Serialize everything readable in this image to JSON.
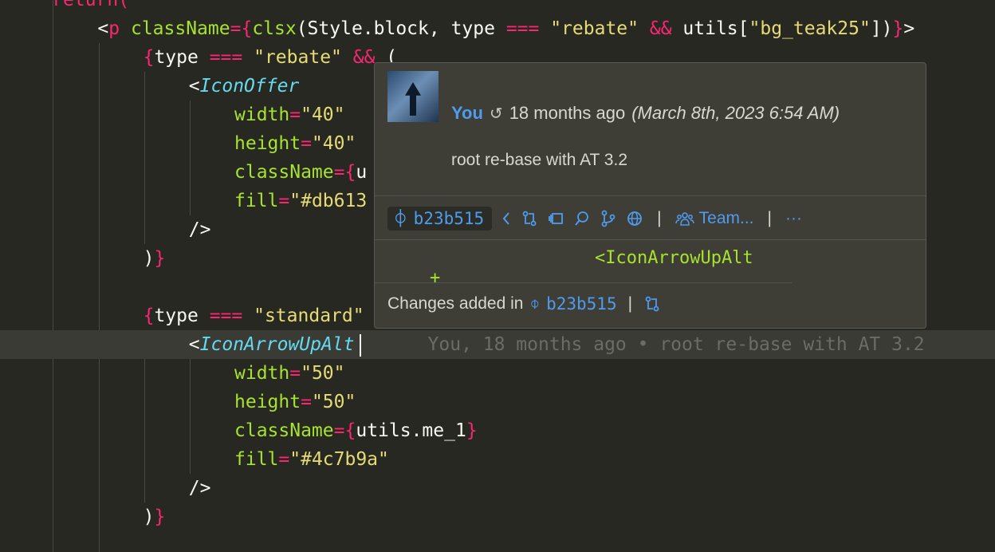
{
  "editor": {
    "lines": [
      {
        "indent": 2,
        "tokens": [
          [
            "tag",
            "return("
          ]
        ]
      },
      {
        "indent": 4,
        "tokens": [
          [
            "p",
            "<"
          ],
          [
            "tag",
            "p"
          ],
          [
            "p",
            " "
          ],
          [
            "attr",
            "className"
          ],
          [
            "op",
            "="
          ],
          [
            "brace",
            "{"
          ],
          [
            "attr",
            "clsx"
          ],
          [
            "p",
            "(Style.block, type "
          ],
          [
            "op",
            "==="
          ],
          [
            "p",
            " "
          ],
          [
            "str",
            "\"rebate\""
          ],
          [
            "p",
            " "
          ],
          [
            "op",
            "&&"
          ],
          [
            "p",
            " utils["
          ],
          [
            "str",
            "\"bg_teak25\""
          ],
          [
            "p",
            "])"
          ],
          [
            "brace",
            "}"
          ],
          [
            "p",
            ">"
          ]
        ]
      },
      {
        "indent": 6,
        "tokens": [
          [
            "brace",
            "{"
          ],
          [
            "p",
            "type "
          ],
          [
            "op",
            "==="
          ],
          [
            "p",
            " "
          ],
          [
            "str",
            "\"rebate\""
          ],
          [
            "p",
            " "
          ],
          [
            "op",
            "&&"
          ],
          [
            "p",
            " ("
          ]
        ]
      },
      {
        "indent": 8,
        "tokens": [
          [
            "p",
            "<"
          ],
          [
            "comp",
            "IconOffer"
          ]
        ]
      },
      {
        "indent": 10,
        "tokens": [
          [
            "attr",
            "width"
          ],
          [
            "op",
            "="
          ],
          [
            "str",
            "\"40\""
          ]
        ]
      },
      {
        "indent": 10,
        "tokens": [
          [
            "attr",
            "height"
          ],
          [
            "op",
            "="
          ],
          [
            "str",
            "\"40\""
          ]
        ]
      },
      {
        "indent": 10,
        "tokens": [
          [
            "attr",
            "className"
          ],
          [
            "op",
            "="
          ],
          [
            "brace",
            "{"
          ],
          [
            "p",
            "u"
          ]
        ]
      },
      {
        "indent": 10,
        "tokens": [
          [
            "attr",
            "fill"
          ],
          [
            "op",
            "="
          ],
          [
            "str",
            "\"#db613"
          ]
        ]
      },
      {
        "indent": 8,
        "tokens": [
          [
            "p",
            "/>"
          ]
        ]
      },
      {
        "indent": 6,
        "tokens": [
          [
            "p",
            ")"
          ],
          [
            "brace",
            "}"
          ]
        ]
      },
      {
        "indent": 0,
        "tokens": []
      },
      {
        "indent": 6,
        "tokens": [
          [
            "brace",
            "{"
          ],
          [
            "p",
            "type "
          ],
          [
            "op",
            "==="
          ],
          [
            "p",
            " "
          ],
          [
            "str",
            "\"standard\""
          ]
        ]
      },
      {
        "indent": 8,
        "tokens": [
          [
            "p",
            "<"
          ],
          [
            "comp",
            "IconArrowUpAlt"
          ]
        ],
        "current": true
      },
      {
        "indent": 10,
        "tokens": [
          [
            "attr",
            "width"
          ],
          [
            "op",
            "="
          ],
          [
            "str",
            "\"50\""
          ]
        ]
      },
      {
        "indent": 10,
        "tokens": [
          [
            "attr",
            "height"
          ],
          [
            "op",
            "="
          ],
          [
            "str",
            "\"50\""
          ]
        ]
      },
      {
        "indent": 10,
        "tokens": [
          [
            "attr",
            "className"
          ],
          [
            "op",
            "="
          ],
          [
            "brace",
            "{"
          ],
          [
            "p",
            "utils.me_1"
          ],
          [
            "brace",
            "}"
          ]
        ]
      },
      {
        "indent": 10,
        "tokens": [
          [
            "attr",
            "fill"
          ],
          [
            "op",
            "="
          ],
          [
            "str",
            "\"#4c7b9a\""
          ]
        ]
      },
      {
        "indent": 8,
        "tokens": [
          [
            "p",
            "/>"
          ]
        ]
      },
      {
        "indent": 6,
        "tokens": [
          [
            "p",
            ")"
          ],
          [
            "brace",
            "}"
          ]
        ]
      }
    ],
    "inline_blame": "You, 18 months ago • root re-base with AT 3.2"
  },
  "popup": {
    "author": "You",
    "relative_time": "18 months ago",
    "full_date": "(March 8th, 2023 6:54 AM)",
    "message": "root re-base with AT 3.2",
    "sha": "b23b515",
    "team_label": "Team...",
    "more_label": "···",
    "diff_sign": "+",
    "diff_text": "<IconArrowUpAlt",
    "changes_label": "Changes added in",
    "changes_sha": "b23b515"
  },
  "colors": {
    "background": "#272822",
    "accent": "#4e9cf0",
    "keyword": "#f92672",
    "attribute": "#a6e22e",
    "string": "#e6db74",
    "component": "#66d9ef"
  }
}
